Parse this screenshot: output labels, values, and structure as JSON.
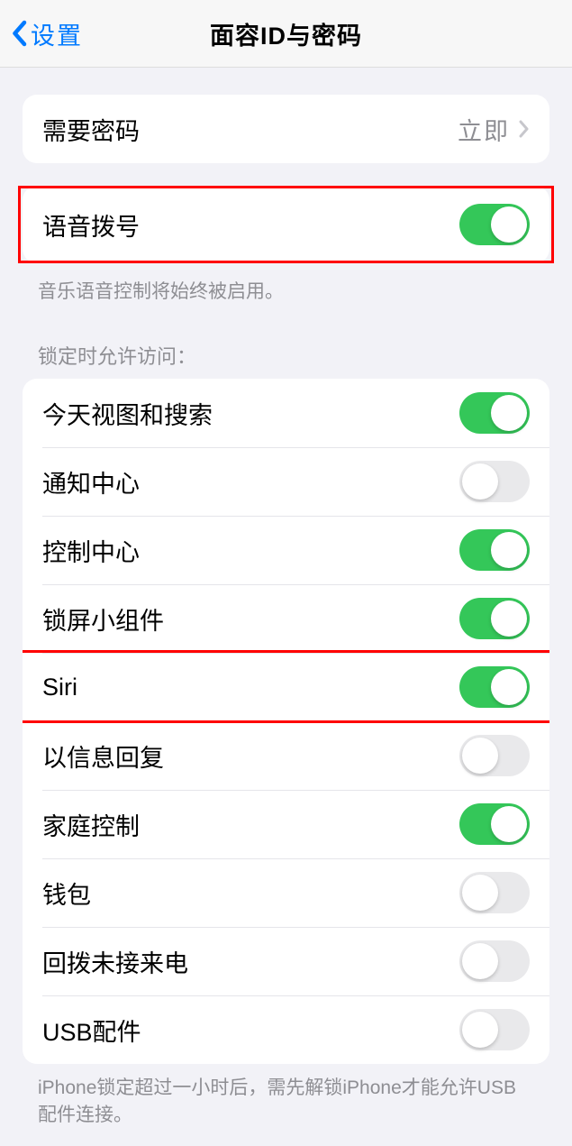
{
  "header": {
    "back_label": "设置",
    "title": "面容ID与密码"
  },
  "passcode_group": {
    "require_passcode": {
      "label": "需要密码",
      "value": "立即"
    }
  },
  "voice_dial_group": {
    "voice_dial": {
      "label": "语音拨号",
      "on": true
    },
    "footer": "音乐语音控制将始终被启用。"
  },
  "lock_access": {
    "header": "锁定时允许访问：",
    "items": [
      {
        "label": "今天视图和搜索",
        "on": true
      },
      {
        "label": "通知中心",
        "on": false
      },
      {
        "label": "控制中心",
        "on": true
      },
      {
        "label": "锁屏小组件",
        "on": true
      },
      {
        "label": "Siri",
        "on": true
      },
      {
        "label": "以信息回复",
        "on": false
      },
      {
        "label": "家庭控制",
        "on": true
      },
      {
        "label": "钱包",
        "on": false
      },
      {
        "label": "回拨未接来电",
        "on": false
      },
      {
        "label": "USB配件",
        "on": false
      }
    ],
    "footer": "iPhone锁定超过一小时后，需先解锁iPhone才能允许USB配件连接。"
  },
  "highlights": {
    "voice_dial": true,
    "siri_index": 4
  }
}
